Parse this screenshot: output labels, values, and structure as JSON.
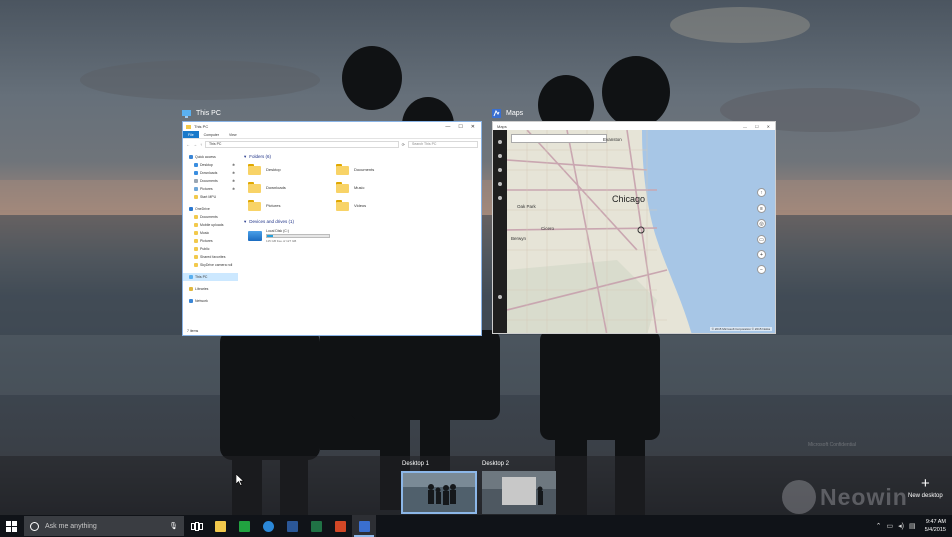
{
  "windows": {
    "explorer": {
      "caption": "This PC",
      "title": "This PC",
      "window_controls": [
        "—",
        "☐",
        "✕"
      ],
      "ribbon_tabs": [
        "File",
        "Computer",
        "View"
      ],
      "nav_buttons": [
        "←",
        "→",
        "↑",
        "⟳"
      ],
      "address": "This PC",
      "search_placeholder": "Search This PC",
      "nav": {
        "quick_access": "Quick access",
        "quick_items": [
          "Desktop",
          "Downloads",
          "Documents",
          "Pictures",
          "Start MPU"
        ],
        "onedrive": "OneDrive",
        "onedrive_items": [
          "Documents",
          "Mobile uploads",
          "Music",
          "Pictures",
          "Public",
          "Shared favorites",
          "SkyDrive camera roll"
        ],
        "this_pc": "This PC",
        "libraries": "Libraries",
        "network": "Network"
      },
      "folders_heading": "Folders (6)",
      "folders": [
        "Desktop",
        "Documents",
        "Downloads",
        "Music",
        "Pictures",
        "Videos"
      ],
      "devices_heading": "Devices and drives (1)",
      "drive": {
        "name": "Local Disk (C:)",
        "free_text": "115 GB free of 127 GB",
        "used_fraction": 0.09
      },
      "status": "7 items"
    },
    "maps": {
      "caption": "Maps",
      "title": "Maps",
      "window_controls": [
        "—",
        "☐",
        "✕"
      ],
      "city": "Chicago",
      "labels": [
        "Oak Park",
        "Berwyn",
        "Cicero",
        "Evanston"
      ],
      "copyright": "© 2015 Microsoft Corporation  © 2015 Nokia"
    }
  },
  "desktops": {
    "desktop1": "Desktop 1",
    "desktop2": "Desktop 2",
    "new_plus": "+",
    "new_label": "New desktop"
  },
  "watermark": {
    "confidential_title": "Microsoft Confidential",
    "brand": "Neowin"
  },
  "taskbar": {
    "search_placeholder": "Ask me anything",
    "clock_time": "9:47 AM",
    "clock_date": "5/4/2015"
  },
  "colors": {
    "accent": "#1979ca",
    "selected_outline": "#8cb7e8",
    "taskbar": "#101318"
  },
  "icons": {
    "start": "windows-logo-icon",
    "cortana": "cortana-ring-icon",
    "mic": "microphone-icon",
    "task_view": "task-view-icon",
    "taskbar_apps": [
      "file-explorer-icon",
      "store-icon",
      "edge-icon",
      "word-icon",
      "excel-icon",
      "powerpoint-icon",
      "maps-icon"
    ],
    "tray": [
      "chevron-up-icon",
      "network-icon",
      "volume-icon",
      "action-center-icon"
    ]
  }
}
